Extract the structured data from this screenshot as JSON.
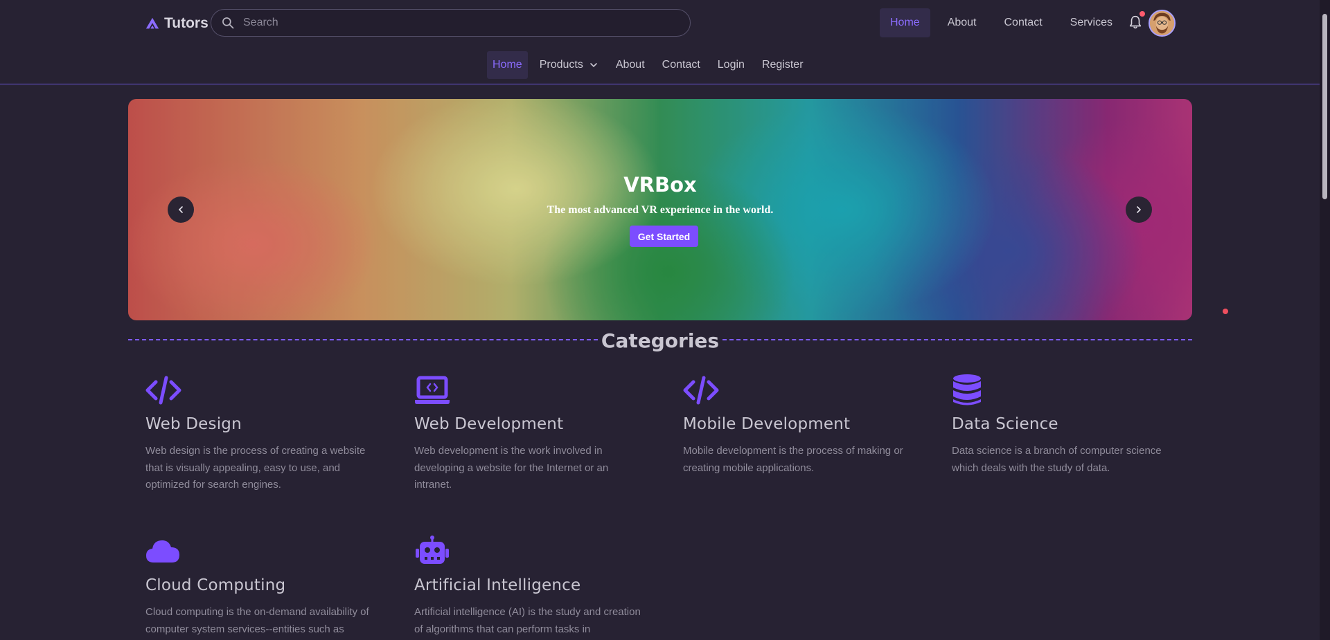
{
  "brand": {
    "name": "Tutors",
    "accent": "#7c4dff"
  },
  "search": {
    "placeholder": "Search"
  },
  "topnav": {
    "items": [
      {
        "label": "Home",
        "active": true
      },
      {
        "label": "About"
      },
      {
        "label": "Contact"
      },
      {
        "label": "Services"
      }
    ],
    "bell_icon": "bell-icon",
    "has_notification": true
  },
  "subnav": {
    "items": [
      {
        "label": "Home",
        "active": true
      },
      {
        "label": "Products",
        "dropdown": true
      },
      {
        "label": "About"
      },
      {
        "label": "Contact"
      },
      {
        "label": "Login"
      },
      {
        "label": "Register"
      }
    ]
  },
  "hero": {
    "title": "VRBox",
    "subtitle": "The most advanced VR experience in the world.",
    "button": "Get Started"
  },
  "categories": {
    "title": "Categories",
    "items": [
      {
        "icon": "code-icon",
        "title": "Web Design",
        "text": "Web design is the process of creating a website that is visually appealing, easy to use, and optimized for search engines."
      },
      {
        "icon": "laptop-code-icon",
        "title": "Web Development",
        "text": "Web development is the work involved in developing a website for the Internet or an intranet."
      },
      {
        "icon": "code-icon",
        "title": "Mobile Development",
        "text": "Mobile development is the process of making or creating mobile applications."
      },
      {
        "icon": "database-icon",
        "title": "Data Science",
        "text": "Data science is a branch of computer science which deals with the study of data."
      },
      {
        "icon": "cloud-icon",
        "title": "Cloud Computing",
        "text": "Cloud computing is the on-demand availability of computer system services--entities such as"
      },
      {
        "icon": "robot-icon",
        "title": "Artificial Intelligence",
        "text": "Artificial intelligence (AI) is the study and creation of algorithms that can perform tasks in"
      }
    ]
  }
}
